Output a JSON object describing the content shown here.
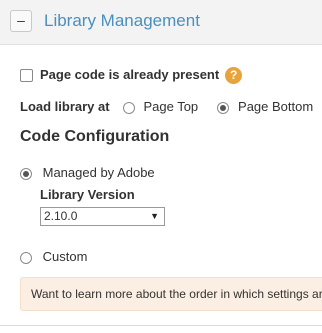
{
  "header": {
    "collapse_symbol": "–",
    "title": "Library Management"
  },
  "page_code": {
    "label": "Page code is already present",
    "checked": false,
    "help_icon": "?"
  },
  "load_library": {
    "label": "Load library at",
    "options": [
      {
        "label": "Page Top",
        "selected": false
      },
      {
        "label": "Page Bottom",
        "selected": true
      }
    ]
  },
  "code_config": {
    "title": "Code Configuration",
    "managed_label": "Managed by Adobe",
    "managed_selected": true,
    "library_version_label": "Library Version",
    "library_version_value": "2.10.0",
    "custom_label": "Custom",
    "custom_selected": false
  },
  "info": {
    "text": "Want to learn more about the order in which settings ar"
  },
  "colors": {
    "title_blue": "#4a8fbd",
    "help_orange": "#e8a33a",
    "info_bg": "#fbeee2"
  }
}
